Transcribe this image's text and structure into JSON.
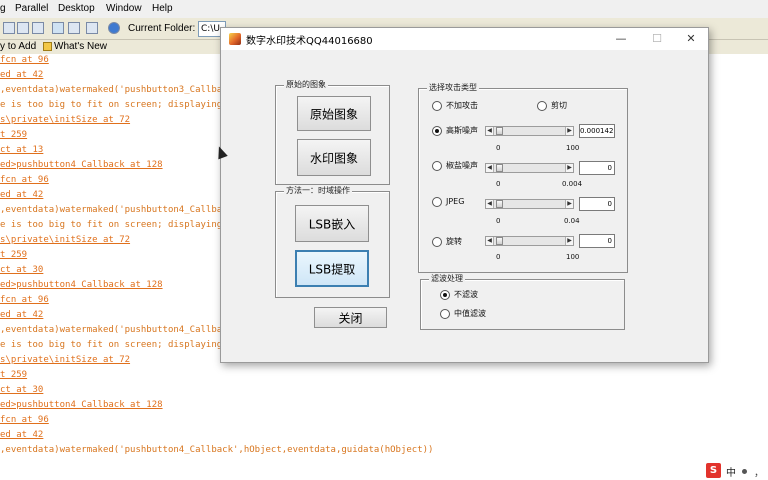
{
  "menu": {
    "items": [
      "g",
      "Parallel",
      "Desktop",
      "Window",
      "Help"
    ]
  },
  "toolbar": {
    "current_folder_label": "Current Folder:",
    "current_folder_value": "C:\\U"
  },
  "shortcuts": {
    "how_to_add": "y to Add",
    "whats_new": "What's New"
  },
  "command_window": {
    "lines": [
      {
        "text": "fcn at 96",
        "style": "lk"
      },
      {
        "text": "ed at 42",
        "style": "lk"
      },
      {
        "text": ",eventdata)watermaked('pushbutton3_Callba",
        "style": "tx"
      },
      {
        "text": "e is too big to fit on screen; displaying a",
        "style": "tx"
      },
      {
        "text": "s\\private\\initSize at 72",
        "style": "lk"
      },
      {
        "text": "t 259",
        "style": "lk"
      },
      {
        "text": "ct at 13",
        "style": "lk"
      },
      {
        "text": "ed>pushbutton4_Callback at 128",
        "style": "lk"
      },
      {
        "text": "fcn at 96",
        "style": "lk"
      },
      {
        "text": "ed at 42",
        "style": "lk"
      },
      {
        "text": ",eventdata)watermaked('pushbutton4_Callba",
        "style": "tx"
      },
      {
        "text": "e is too big to fit on screen; displaying a",
        "style": "tx"
      },
      {
        "text": "s\\private\\initSize at 72",
        "style": "lk"
      },
      {
        "text": "t 259",
        "style": "lk"
      },
      {
        "text": "ct at 30",
        "style": "lk"
      },
      {
        "text": "ed>pushbutton4_Callback at 128",
        "style": "lk"
      },
      {
        "text": "fcn at 96",
        "style": "lk"
      },
      {
        "text": "ed at 42",
        "style": "lk"
      },
      {
        "text": ",eventdata)watermaked('pushbutton4_Callba",
        "style": "tx"
      },
      {
        "text": "e is too big to fit on screen; displaying a",
        "style": "tx"
      },
      {
        "text": "s\\private\\initSize at 72",
        "style": "lk"
      },
      {
        "text": "t 259",
        "style": "lk"
      },
      {
        "text": "ct at 30",
        "style": "lk"
      },
      {
        "text": "ed>pushbutton4_Callback at 128",
        "style": "lk"
      },
      {
        "text": "fcn at 96",
        "style": "lk"
      },
      {
        "text": "ed at 42",
        "style": "lk"
      },
      {
        "text": ",eventdata)watermaked('pushbutton4_Callback',hObject,eventdata,guidata(hObject))",
        "style": "tx"
      }
    ]
  },
  "figure": {
    "title": "数字水印技术QQ44016680",
    "controls": {
      "minimize": "—",
      "maximize": "☐",
      "close": "✕"
    },
    "original_panel": {
      "title": "原始的图象",
      "original_button": "原始图象",
      "watermark_button": "水印图象"
    },
    "method_panel": {
      "title": "方法一：时域操作",
      "embed_button": "LSB嵌入",
      "extract_button": "LSB提取"
    },
    "close_button": "关闭",
    "attack_panel": {
      "title": "选择攻击类型",
      "no_attack": {
        "label": "不加攻击",
        "selected": false
      },
      "crop": {
        "label": "剪切",
        "selected": false
      },
      "gaussian": {
        "label": "高斯噪声",
        "selected": true,
        "min": "0",
        "max": "100",
        "value": "0.000142",
        "level": 0.0
      },
      "salt_pepper": {
        "label": "椒盐噪声",
        "selected": false,
        "min": "0",
        "max": "0.004",
        "value": "0",
        "level": 0.0
      },
      "jpeg": {
        "label": "JPEG",
        "selected": false,
        "min": "0",
        "max": "0.04",
        "value": "0",
        "level": 0.0
      },
      "rotate": {
        "label": "旋转",
        "selected": false,
        "min": "0",
        "max": "100",
        "value": "0",
        "level": 0.0
      }
    },
    "filter_panel": {
      "title": "滤波处理",
      "no_filter": {
        "label": "不滤波",
        "selected": true
      },
      "median": {
        "label": "中值滤波",
        "selected": false
      }
    }
  },
  "ime": {
    "logo": "S",
    "lang": "中",
    "punct": "，"
  }
}
